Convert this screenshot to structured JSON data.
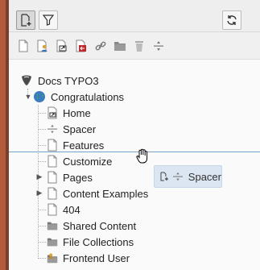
{
  "toolbar": {
    "new_page_icon": "new-page-icon",
    "filter_icon": "filter-icon",
    "refresh_icon": "refresh-icon"
  },
  "doktype_icons": [
    "page-standard-icon",
    "page-backend-user-icon",
    "page-shortcut-icon",
    "page-external-link-icon",
    "page-link-icon",
    "folder-icon",
    "recycler-icon",
    "spacer-icon"
  ],
  "tree": {
    "root": {
      "label": "Docs TYPO3",
      "icon": "typo3-logo-icon"
    },
    "site": {
      "label": "Congratulations",
      "icon": "globe-icon"
    },
    "children": [
      {
        "label": "Home",
        "icon": "page-shortcut-icon"
      },
      {
        "label": "Spacer",
        "icon": "spacer-icon"
      },
      {
        "label": "Features",
        "icon": "page-standard-icon"
      },
      {
        "label": "Customize",
        "icon": "page-standard-icon"
      },
      {
        "label": "Pages",
        "icon": "page-standard-icon",
        "expandable": true
      },
      {
        "label": "Content Examples",
        "icon": "page-standard-icon",
        "expandable": true
      },
      {
        "label": "404",
        "icon": "page-standard-icon"
      },
      {
        "label": "Shared Content",
        "icon": "folder-icon"
      },
      {
        "label": "File Collections",
        "icon": "folder-icon"
      },
      {
        "label": "Frontend User",
        "icon": "frontend-user-folder-icon"
      }
    ]
  },
  "drag_tooltip": {
    "label": "Spacer",
    "icon": "spacer-icon"
  },
  "colors": {
    "accent": "#b35a3a",
    "drop_indicator": "#7aa3c7",
    "tooltip_bg": "#dbe6f2"
  }
}
